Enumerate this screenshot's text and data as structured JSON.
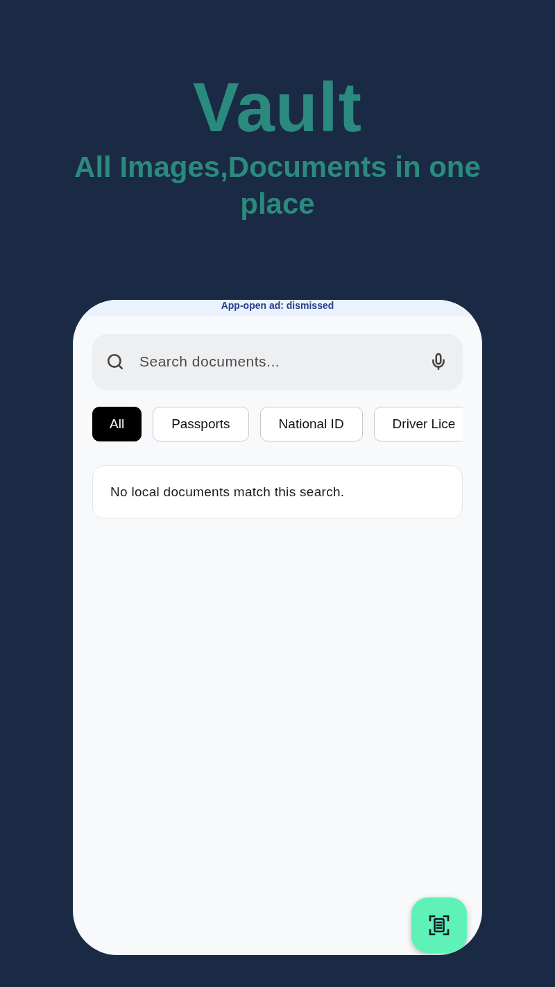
{
  "header": {
    "title": "Vault",
    "subtitle": "All Images,Documents in one place"
  },
  "banner": {
    "text": "App-open ad: dismissed"
  },
  "search": {
    "placeholder": "Search documents..."
  },
  "filters": [
    {
      "label": "All",
      "selected": true
    },
    {
      "label": "Passports",
      "selected": false
    },
    {
      "label": "National ID",
      "selected": false
    },
    {
      "label": "Driver Lice",
      "selected": false
    }
  ],
  "empty_message": "No local documents match this search."
}
